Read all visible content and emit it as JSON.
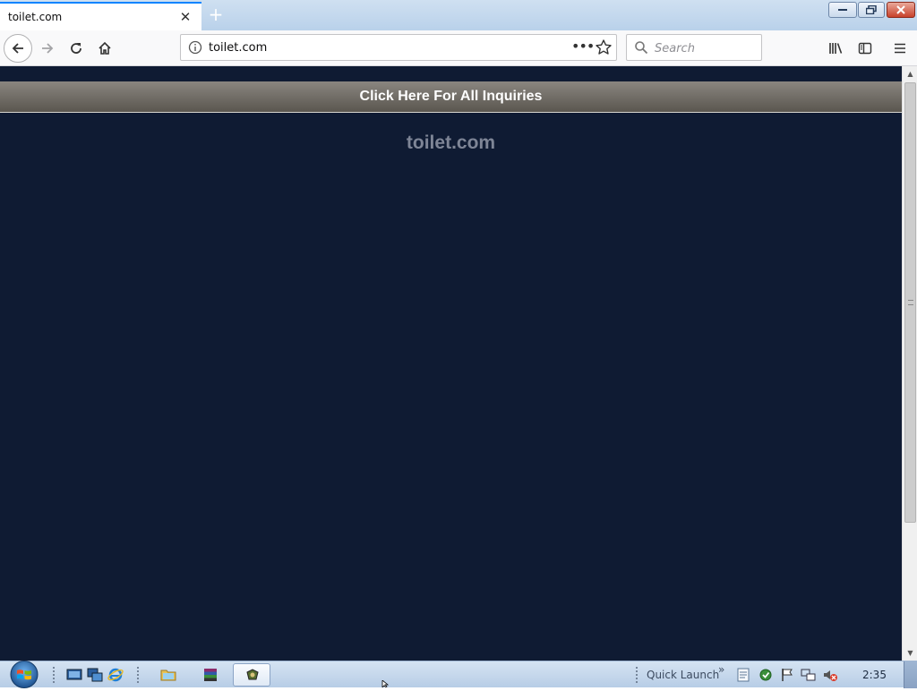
{
  "browser": {
    "tab": {
      "title": "toilet.com",
      "close_symbol": "✕",
      "new_tab_symbol": "+"
    },
    "url": "toilet.com",
    "page_actions_symbol": "•••",
    "search": {
      "placeholder": "Search",
      "value": ""
    }
  },
  "page": {
    "inquiry_banner": "Click Here For All Inquiries",
    "domain_title": "toilet.com",
    "colors": {
      "background": "#0f1b33",
      "banner": "#6e6a63",
      "title": "#7e8596"
    }
  },
  "scrollbar": {
    "up_symbol": "▲",
    "down_symbol": "▼"
  },
  "taskbar": {
    "quick_launch_label": "Quick Launch",
    "quick_launch_chevron": "»",
    "clock": "2:35"
  },
  "icons": [
    "back-icon",
    "forward-icon",
    "reload-icon",
    "home-icon",
    "info-icon",
    "star-icon",
    "search-icon",
    "library-icon",
    "sidebar-icon",
    "menu-icon",
    "windows-start-icon",
    "show-desktop-icon",
    "switch-windows-icon",
    "internet-explorer-icon",
    "folder-icon",
    "winrar-icon",
    "app-icon",
    "volume-muted-icon",
    "network-icon",
    "flag-icon",
    "security-icon",
    "file-icon"
  ]
}
